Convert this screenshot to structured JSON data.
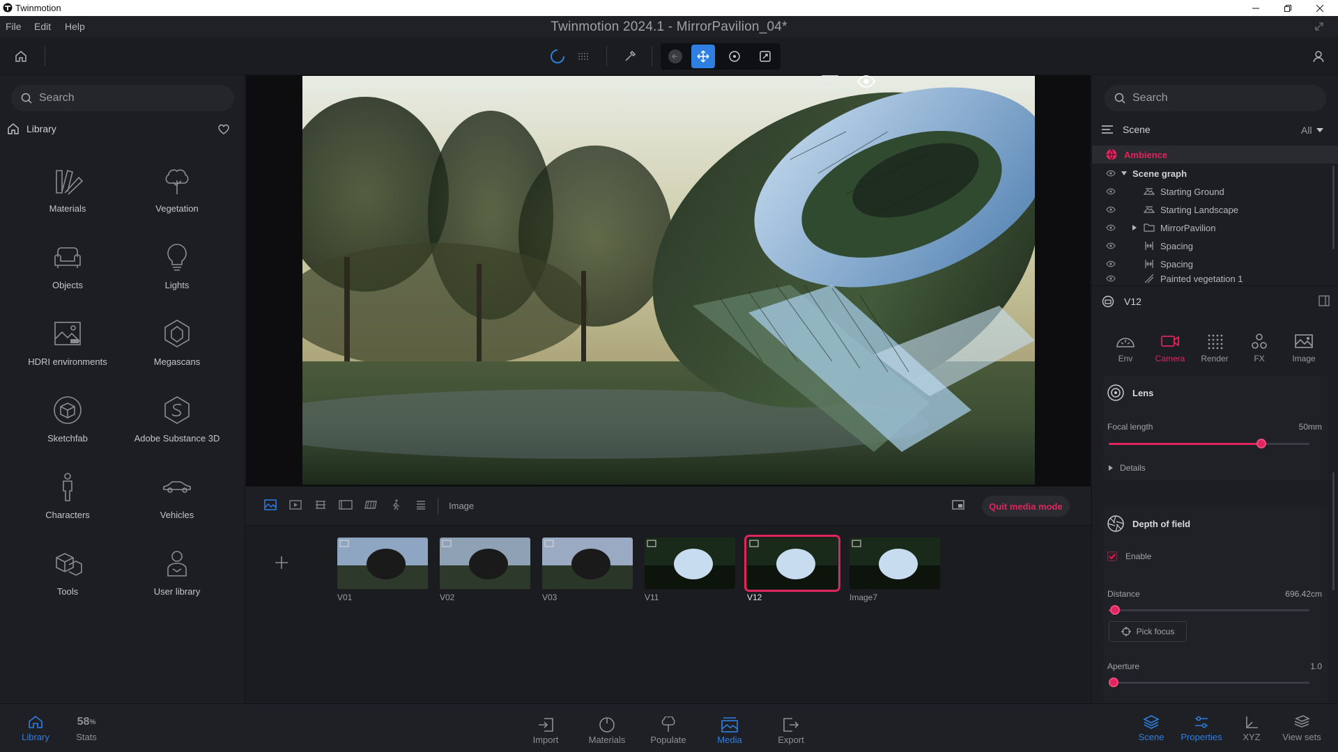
{
  "window": {
    "app_name": "Twinmotion"
  },
  "menubar": {
    "items": [
      "File",
      "Edit",
      "Help"
    ],
    "title": "Twinmotion 2024.1 - MirrorPavilion_04*"
  },
  "left_panel": {
    "search_placeholder": "Search",
    "section": "Library",
    "items": [
      {
        "label": "Materials",
        "icon": "materials-icon"
      },
      {
        "label": "Vegetation",
        "icon": "tree-icon"
      },
      {
        "label": "Objects",
        "icon": "sofa-icon"
      },
      {
        "label": "Lights",
        "icon": "bulb-icon"
      },
      {
        "label": "HDRI environments",
        "icon": "hdri-icon"
      },
      {
        "label": "Megascans",
        "icon": "megascans-icon"
      },
      {
        "label": "Sketchfab",
        "icon": "sketchfab-icon"
      },
      {
        "label": "Adobe Substance 3D",
        "icon": "substance-icon"
      },
      {
        "label": "Characters",
        "icon": "character-icon"
      },
      {
        "label": "Vehicles",
        "icon": "car-icon"
      },
      {
        "label": "Tools",
        "icon": "tools-icon"
      },
      {
        "label": "User library",
        "icon": "user-library-icon"
      }
    ]
  },
  "media_bar": {
    "mode_label": "Image",
    "quit_label": "Quit media mode"
  },
  "filmstrip": {
    "thumbs": [
      {
        "label": "V01"
      },
      {
        "label": "V02"
      },
      {
        "label": "V03"
      },
      {
        "label": "V11"
      },
      {
        "label": "V12",
        "selected": true
      },
      {
        "label": "Image7"
      }
    ]
  },
  "right_panel": {
    "search_placeholder": "Search",
    "scene_label": "Scene",
    "filter": "All",
    "tree": {
      "ambience": "Ambience",
      "graph": "Scene graph",
      "items": [
        "Starting Ground",
        "Starting Landscape",
        "MirrorPavilion",
        "Spacing",
        "Spacing",
        "Painted vegetation 1"
      ]
    },
    "properties_title": "V12",
    "tabs": [
      {
        "label": "Env"
      },
      {
        "label": "Camera",
        "active": true
      },
      {
        "label": "Render"
      },
      {
        "label": "FX"
      },
      {
        "label": "Image"
      }
    ],
    "lens": {
      "title": "Lens",
      "focal_label": "Focal length",
      "focal_value": "50mm",
      "focal_fraction": 0.76,
      "details": "Details"
    },
    "dof": {
      "title": "Depth of field",
      "enable_label": "Enable",
      "enabled": true,
      "distance_label": "Distance",
      "distance_value": "696.42cm",
      "distance_fraction": 0.03,
      "pick_focus": "Pick focus",
      "aperture_label": "Aperture",
      "aperture_value": "1.0",
      "aperture_fraction": 0.0
    }
  },
  "bottom_bar": {
    "left": [
      {
        "label": "Library",
        "active": true
      },
      {
        "label": "Stats",
        "value": "58",
        "unit": "%"
      }
    ],
    "center": [
      {
        "label": "Import"
      },
      {
        "label": "Materials"
      },
      {
        "label": "Populate"
      },
      {
        "label": "Media",
        "active": true
      },
      {
        "label": "Export"
      }
    ],
    "right": [
      {
        "label": "Scene",
        "active": true
      },
      {
        "label": "Properties",
        "active": true
      },
      {
        "label": "XYZ"
      },
      {
        "label": "View sets"
      }
    ]
  },
  "colors": {
    "accent": "#e0245e",
    "active_blue": "#2f7fe0",
    "selection_bg": "#2a2b31"
  }
}
